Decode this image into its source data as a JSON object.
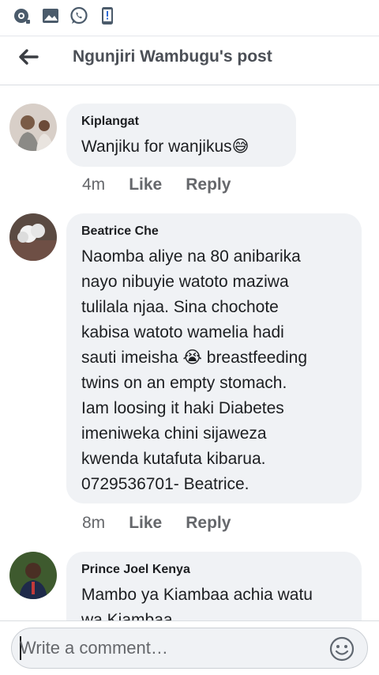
{
  "status_bar": {
    "icons": [
      "camera-lens-icon",
      "gallery-icon",
      "whatsapp-icon",
      "phone-notification-icon"
    ]
  },
  "header": {
    "title": "Ngunjiri Wambugu's post",
    "back_icon": "arrow-left-icon"
  },
  "comments": [
    {
      "author": "Kiplangat",
      "text": "Wanjiku for wanjikus😅",
      "time": "4m",
      "like": "Like",
      "reply": "Reply"
    },
    {
      "author": "Beatrice Che",
      "text": "Naomba aliye na 80 anibarika\nnayo nibuyie watoto maziwa\ntulilala njaa. Sina chochote\nkabisa watoto wamelia hadi\nsauti imeisha 😭 breastfeeding\ntwins on an empty stomach.\nIam loosing it haki Diabetes\nimeniweka chini sijaweza\nkwenda kutafuta kibarua.\n0729536701- Beatrice.",
      "time": "8m",
      "like": "Like",
      "reply": "Reply"
    },
    {
      "author": "Prince Joel Kenya",
      "text": "Mambo ya Kiambaa achia watu\nwa Kiambaa"
    }
  ],
  "composer": {
    "placeholder": "Write a comment…",
    "emoji_icon": "smiley-face-icon"
  }
}
